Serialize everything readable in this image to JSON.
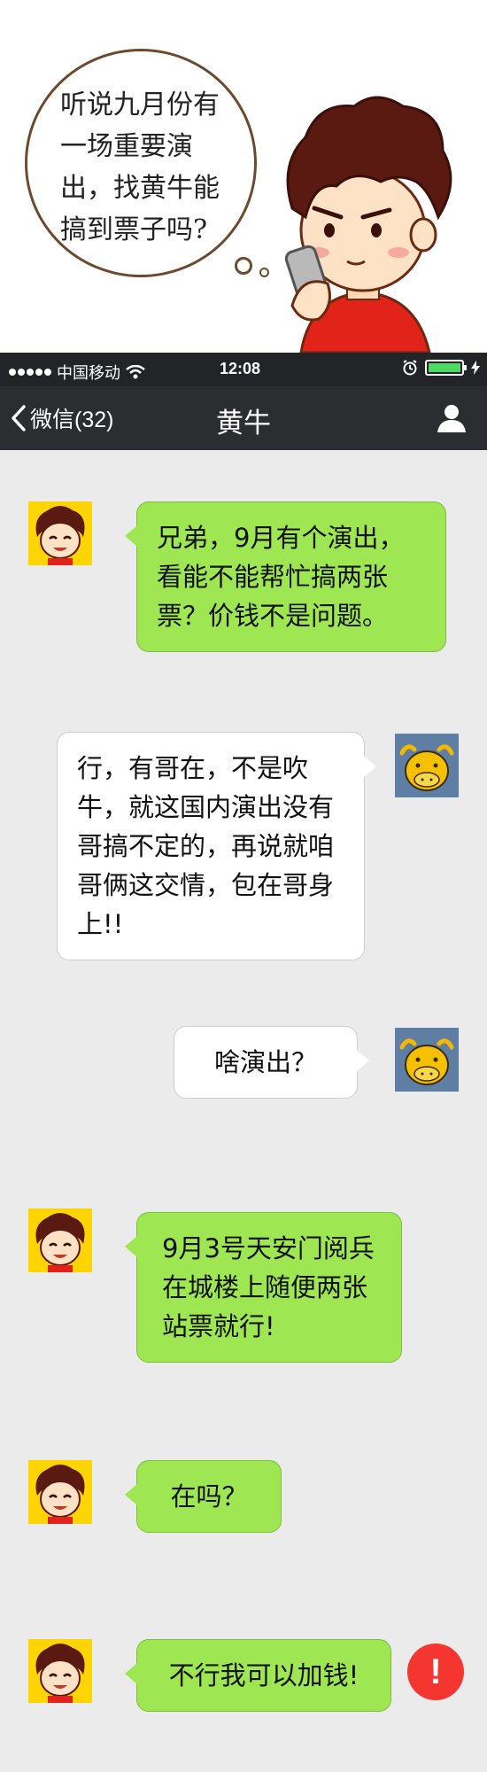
{
  "comic": {
    "thought_lines": [
      "听说九月份有",
      "一场重要演",
      "出，找黄牛能",
      "搞到票子吗?"
    ]
  },
  "status_bar": {
    "carrier": "中国移动",
    "time": "12:08"
  },
  "nav": {
    "back_label": "微信(32)",
    "title": "黄牛"
  },
  "messages": [
    {
      "from": "me",
      "avatar": "boy-avatar",
      "text": "兄弟，9月有个演出，看能不能帮忙搞两张票？价钱不是问题。"
    },
    {
      "from": "other",
      "avatar": "ox-avatar",
      "text": "行，有哥在，不是吹牛，就这国内演出没有哥搞不定的，再说就咱哥俩这交情，包在哥身上!!"
    },
    {
      "from": "other",
      "avatar": "ox-avatar",
      "text": "啥演出？"
    },
    {
      "from": "me",
      "avatar": "boy-avatar",
      "text": "9月3号天安门阅兵在城楼上随便两张站票就行!"
    },
    {
      "from": "me",
      "avatar": "boy-avatar",
      "text": "在吗？"
    },
    {
      "from": "me",
      "avatar": "boy-avatar",
      "text": "不行我可以加钱!",
      "failed": true,
      "failed_icon_text": "!"
    }
  ],
  "colors": {
    "bubble_green": "#9ee652",
    "bubble_white": "#ffffff",
    "chat_bg": "#ebebeb",
    "nav_bg": "#2c2d31",
    "error_red": "#f43530"
  }
}
